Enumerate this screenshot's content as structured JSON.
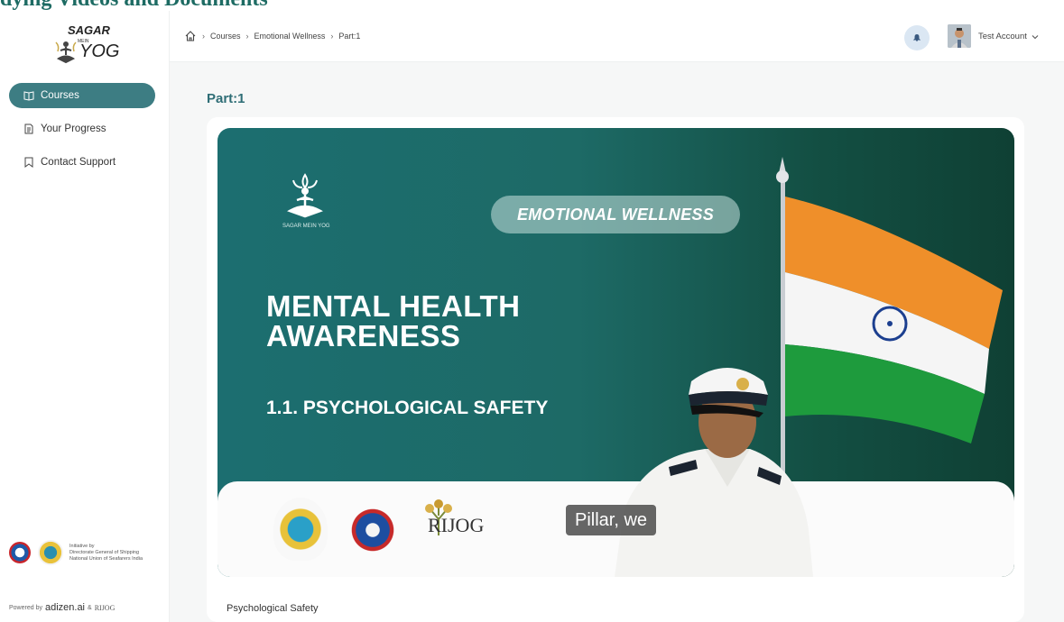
{
  "page_heading": "dying Videos and Documents",
  "brand": {
    "line1": "SAGAR",
    "line2": "MEIN",
    "line3": "YOG"
  },
  "sidebar": {
    "items": [
      {
        "label": "Courses",
        "icon": "book-open-icon",
        "active": true
      },
      {
        "label": "Your Progress",
        "icon": "document-icon",
        "active": false
      },
      {
        "label": "Contact Support",
        "icon": "bookmark-icon",
        "active": false
      }
    ],
    "initiative": {
      "line1": "Initiative by",
      "line2": "Directorate General of Shipping",
      "line3": "National Union of Seafarers India"
    },
    "powered": {
      "prefix": "Powered by",
      "brand": "adizen.ai",
      "amp": "&",
      "partner": "RIJOG"
    }
  },
  "header": {
    "breadcrumb": [
      "Courses",
      "Emotional Wellness",
      "Part:1"
    ],
    "user_name": "Test Account"
  },
  "main": {
    "title": "Part:1",
    "caption": "Psychological Safety",
    "video": {
      "logo_text": "SAGAR MEIN YOG",
      "tag": "EMOTIONAL WELLNESS",
      "headline_1": "MENTAL HEALTH",
      "headline_2": "AWARENESS",
      "subheading": "1.1. PSYCHOLOGICAL SAFETY",
      "subtitle": "Pillar, we",
      "partner_logo": "RIJOG"
    }
  },
  "colors": {
    "accent": "#3d7d83",
    "video_bg_start": "#1c6e70",
    "video_bg_end": "#0f4034",
    "bell_bg": "#dbe7f3"
  }
}
